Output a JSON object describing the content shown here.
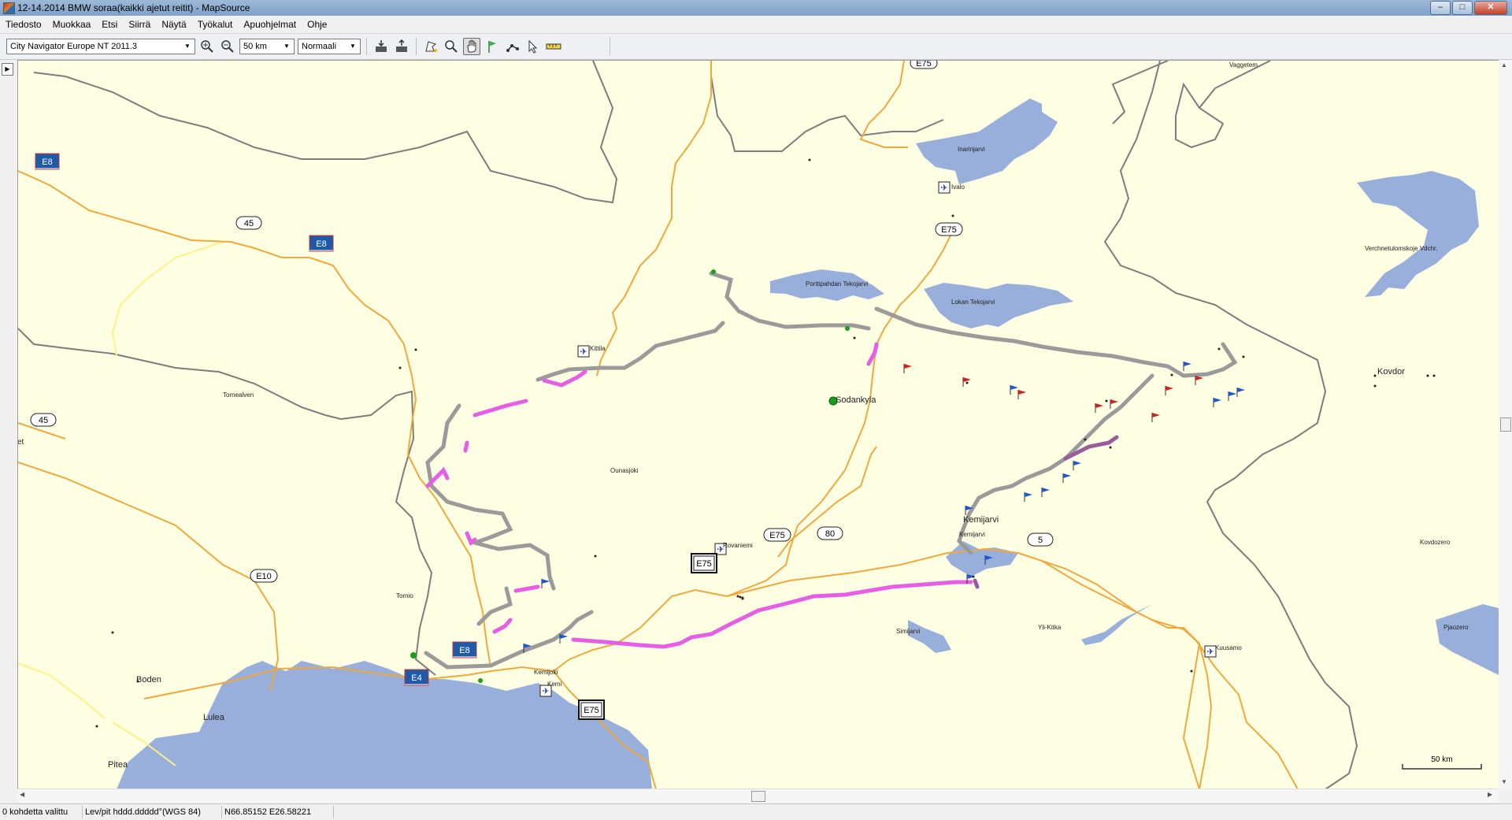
{
  "window": {
    "title": "12-14.2014 BMW soraa(kaikki ajetut reitit) - MapSource"
  },
  "menu": [
    "Tiedosto",
    "Muokkaa",
    "Etsi",
    "Siirrä",
    "Näytä",
    "Työkalut",
    "Apuohjelmat",
    "Ohje"
  ],
  "toolbar": {
    "map_product": "City Navigator Europe NT 2011.3",
    "zoom_scale": "50 km",
    "detail_level": "Normaali"
  },
  "map": {
    "colors": {
      "land": "#fefee3",
      "water": "#98afdb",
      "border": "#7c7c7c",
      "road": "#f0a83c",
      "minor_road": "#fdf085",
      "track": "#9a9a9a",
      "highlight": "#e75de6",
      "dark_highlight": "#9a5c9c"
    },
    "shields": [
      {
        "id": "e8-a",
        "text": "E8",
        "style": "euro"
      },
      {
        "id": "e8-b",
        "text": "E8",
        "style": "euro"
      },
      {
        "id": "e8-c",
        "text": "E8",
        "style": "euro"
      },
      {
        "id": "e4",
        "text": "E4",
        "style": "euro"
      },
      {
        "id": "r45-a",
        "text": "45",
        "style": "oval"
      },
      {
        "id": "r45-b",
        "text": "45",
        "style": "oval"
      },
      {
        "id": "e10",
        "text": "E10",
        "style": "oval"
      },
      {
        "id": "e75-top",
        "text": "E75",
        "style": "oval"
      },
      {
        "id": "e75-b",
        "text": "E75",
        "style": "oval"
      },
      {
        "id": "e75-c",
        "text": "E75",
        "style": "oval"
      },
      {
        "id": "r80",
        "text": "80",
        "style": "oval"
      },
      {
        "id": "r5",
        "text": "5",
        "style": "oval"
      },
      {
        "id": "e75-box1",
        "text": "E75",
        "style": "box"
      },
      {
        "id": "e75-box2",
        "text": "E75",
        "style": "box"
      }
    ],
    "place_labels": [
      {
        "id": "vaggetem",
        "text": "Vaggetem",
        "size": "small"
      },
      {
        "id": "inarinjarvi",
        "text": "Inarinjarvi",
        "size": "small"
      },
      {
        "id": "ivalo",
        "text": "Ivalo",
        "size": "small"
      },
      {
        "id": "verchnetulomskoje",
        "text": "Verchnetulomskoje Vdchr.",
        "size": "small"
      },
      {
        "id": "porttipahdan",
        "text": "Porttipahdan Tekojarvi",
        "size": "small"
      },
      {
        "id": "lokan",
        "text": "Lokan Tekojarvi",
        "size": "small"
      },
      {
        "id": "kittila",
        "text": "Kittila",
        "size": "small"
      },
      {
        "id": "sodankyla",
        "text": "Sodankyla",
        "size": "large"
      },
      {
        "id": "kovdor",
        "text": "Kovdor",
        "size": "large"
      },
      {
        "id": "tornealven",
        "text": "Tornealven",
        "size": "small"
      },
      {
        "id": "ounasjoki",
        "text": "Ounasjoki",
        "size": "small"
      },
      {
        "id": "rovaniemi",
        "text": "Rovaniemi",
        "size": "small"
      },
      {
        "id": "kemijarvi-town",
        "text": "Kemijarvi",
        "size": "large"
      },
      {
        "id": "kemijarvi-lake",
        "text": "Kemijarvi",
        "size": "small"
      },
      {
        "id": "kovdozero",
        "text": "Kovdozero",
        "size": "small"
      },
      {
        "id": "tornio",
        "text": "Tornio",
        "size": "small"
      },
      {
        "id": "simijarvi",
        "text": "Simijarvi",
        "size": "small"
      },
      {
        "id": "yli-kitka",
        "text": "Yli-Kitka",
        "size": "small"
      },
      {
        "id": "kuusamo",
        "text": "Kuusamo",
        "size": "small"
      },
      {
        "id": "pjaozero",
        "text": "Pjaozero",
        "size": "small"
      },
      {
        "id": "kemijoki",
        "text": "Kemijoki",
        "size": "small"
      },
      {
        "id": "kemi",
        "text": "Kemi",
        "size": "small"
      },
      {
        "id": "boden",
        "text": "Boden",
        "size": "large"
      },
      {
        "id": "lulea",
        "text": "Lulea",
        "size": "large"
      },
      {
        "id": "pitea",
        "text": "Pitea",
        "size": "large"
      },
      {
        "id": "edge-et",
        "text": "et",
        "size": "small"
      }
    ],
    "scale_bar": "50 km"
  },
  "status": {
    "selection": "0 kohdetta valittu",
    "format": "Lev/pit hddd.ddddd°(WGS 84)",
    "coords": "N66.85152 E26.58221"
  }
}
